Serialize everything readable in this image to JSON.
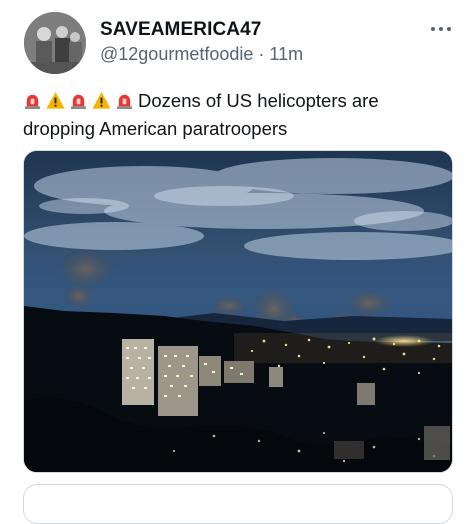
{
  "tweet": {
    "display_name": "SAVEAMERICA47",
    "handle": "@12gourmetfoodie",
    "separator": "·",
    "time": "11m",
    "text": "Dozens of US helicopters are dropping American paratroopers",
    "emoji_prefix": [
      "siren-icon",
      "warning-icon",
      "siren-icon",
      "warning-icon",
      "siren-icon"
    ]
  },
  "colors": {
    "text": "#0f1419",
    "secondary": "#536471",
    "siren": "#e53935",
    "warning": "#f4b400"
  }
}
